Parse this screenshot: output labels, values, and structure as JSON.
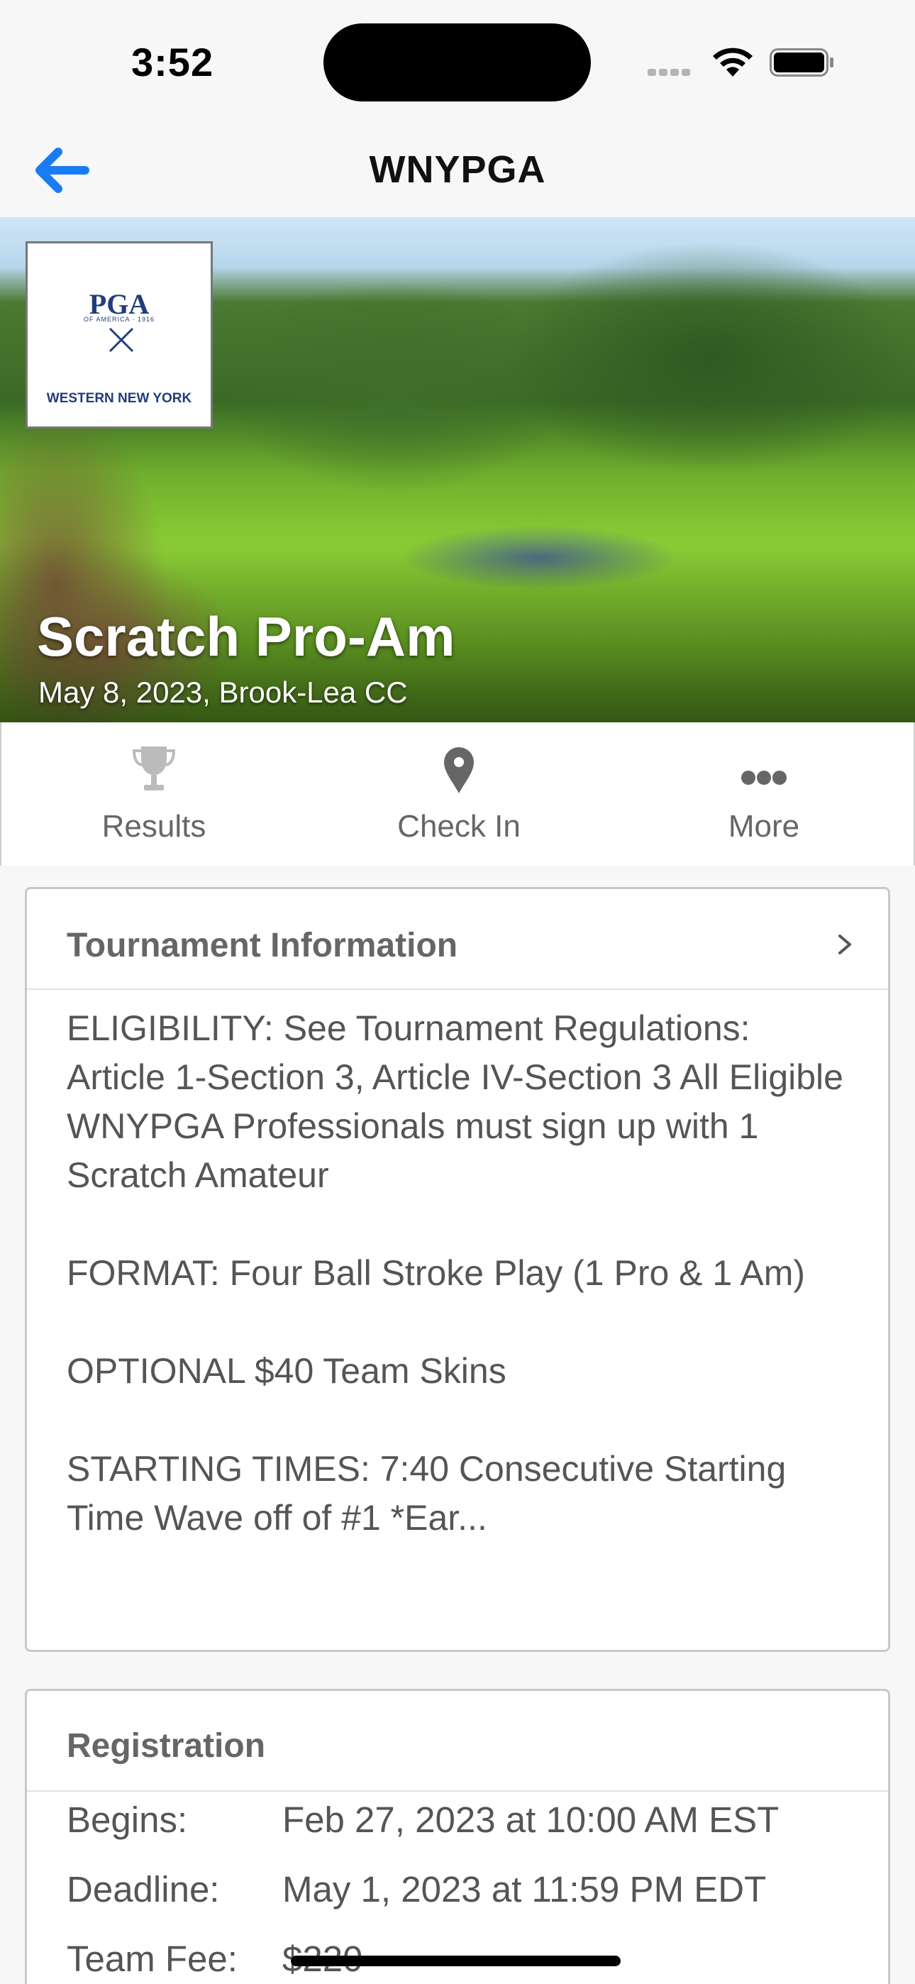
{
  "status_bar": {
    "time": "3:52"
  },
  "nav": {
    "title": "WNYPGA",
    "back_icon": "arrow-left-icon",
    "accent_color": "#1a7cf5"
  },
  "hero": {
    "logo": {
      "mark": "PGA",
      "sub": "OF AMERICA · 1916",
      "region": "WESTERN NEW YORK"
    },
    "title": "Scratch Pro-Am",
    "subtitle": "May 8, 2023, Brook-Lea CC"
  },
  "actions": [
    {
      "label": "Results",
      "icon": "trophy-icon"
    },
    {
      "label": "Check In",
      "icon": "map-pin-icon"
    },
    {
      "label": "More",
      "icon": "more-dots-icon"
    }
  ],
  "tournament_info": {
    "title": "Tournament Information",
    "paragraphs": [
      "ELIGIBILITY: See Tournament Regulations: Article 1-Section 3, Article IV-Section 3 All Eligible WNYPGA Professionals must sign up with 1 Scratch Amateur",
      "FORMAT: Four Ball Stroke Play (1 Pro & 1 Am)",
      "OPTIONAL $40 Team Skins",
      "STARTING TIMES: 7:40 Consecutive Starting Time Wave off of #1 *Ear..."
    ]
  },
  "registration": {
    "title": "Registration",
    "rows": [
      {
        "label": "Begins:",
        "value": "Feb 27, 2023 at 10:00 AM EST"
      },
      {
        "label": "Deadline:",
        "value": "May 1, 2023 at 11:59 PM EDT"
      },
      {
        "label": "Team Fee:",
        "value": "$220"
      }
    ]
  }
}
